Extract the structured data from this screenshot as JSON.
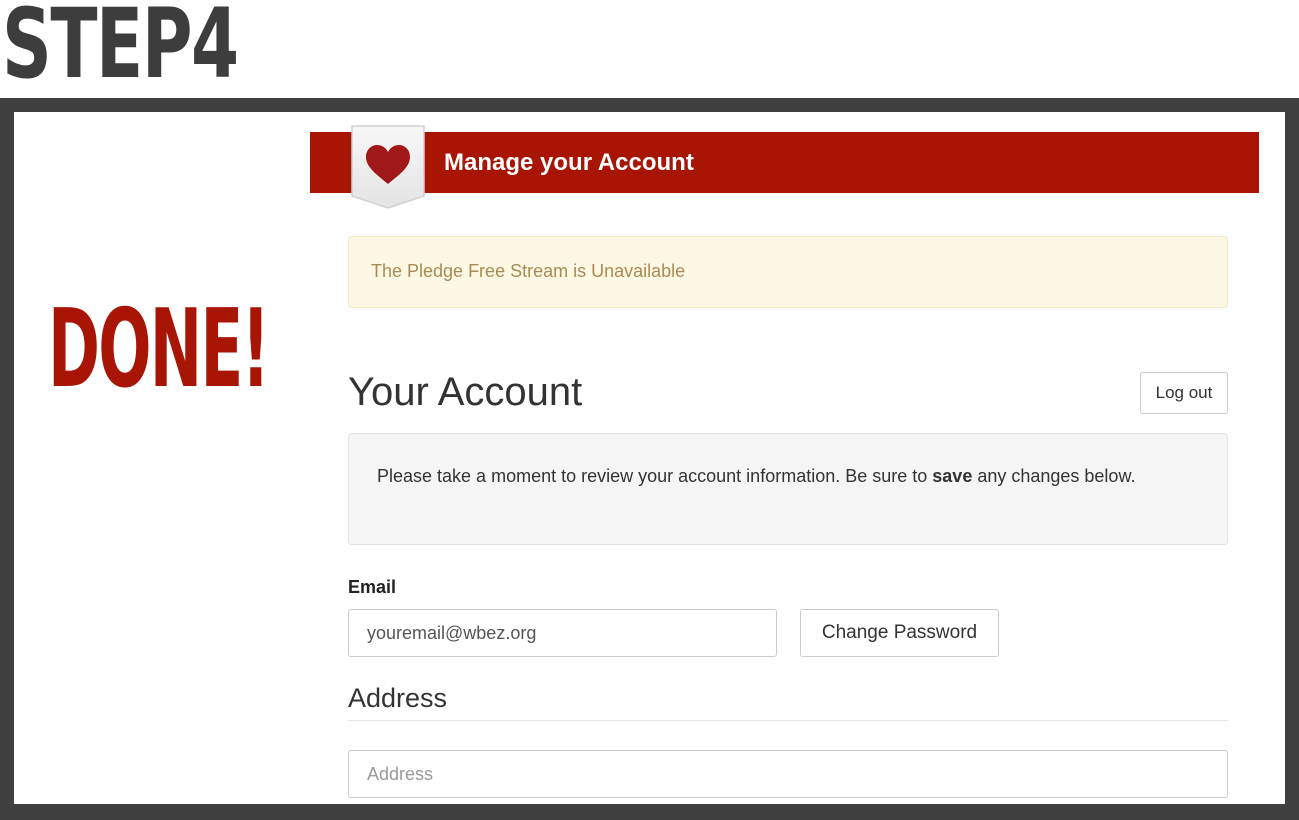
{
  "step": {
    "title": "STEP4"
  },
  "sidebar": {
    "done_text": "DONE!"
  },
  "banner": {
    "title": "Manage your Account",
    "icon": "heart-icon",
    "color": "#a81505"
  },
  "alert": {
    "text": "The Pledge Free Stream is Unavailable"
  },
  "account": {
    "title": "Your Account",
    "logout_label": "Log out",
    "notice_before": "Please take a moment to review your account information. Be sure to ",
    "notice_bold": "save",
    "notice_after": " any changes below."
  },
  "email": {
    "label": "Email",
    "value": "youremail@wbez.org",
    "change_password_label": "Change Password"
  },
  "address": {
    "section_title": "Address",
    "placeholder": "Address"
  }
}
